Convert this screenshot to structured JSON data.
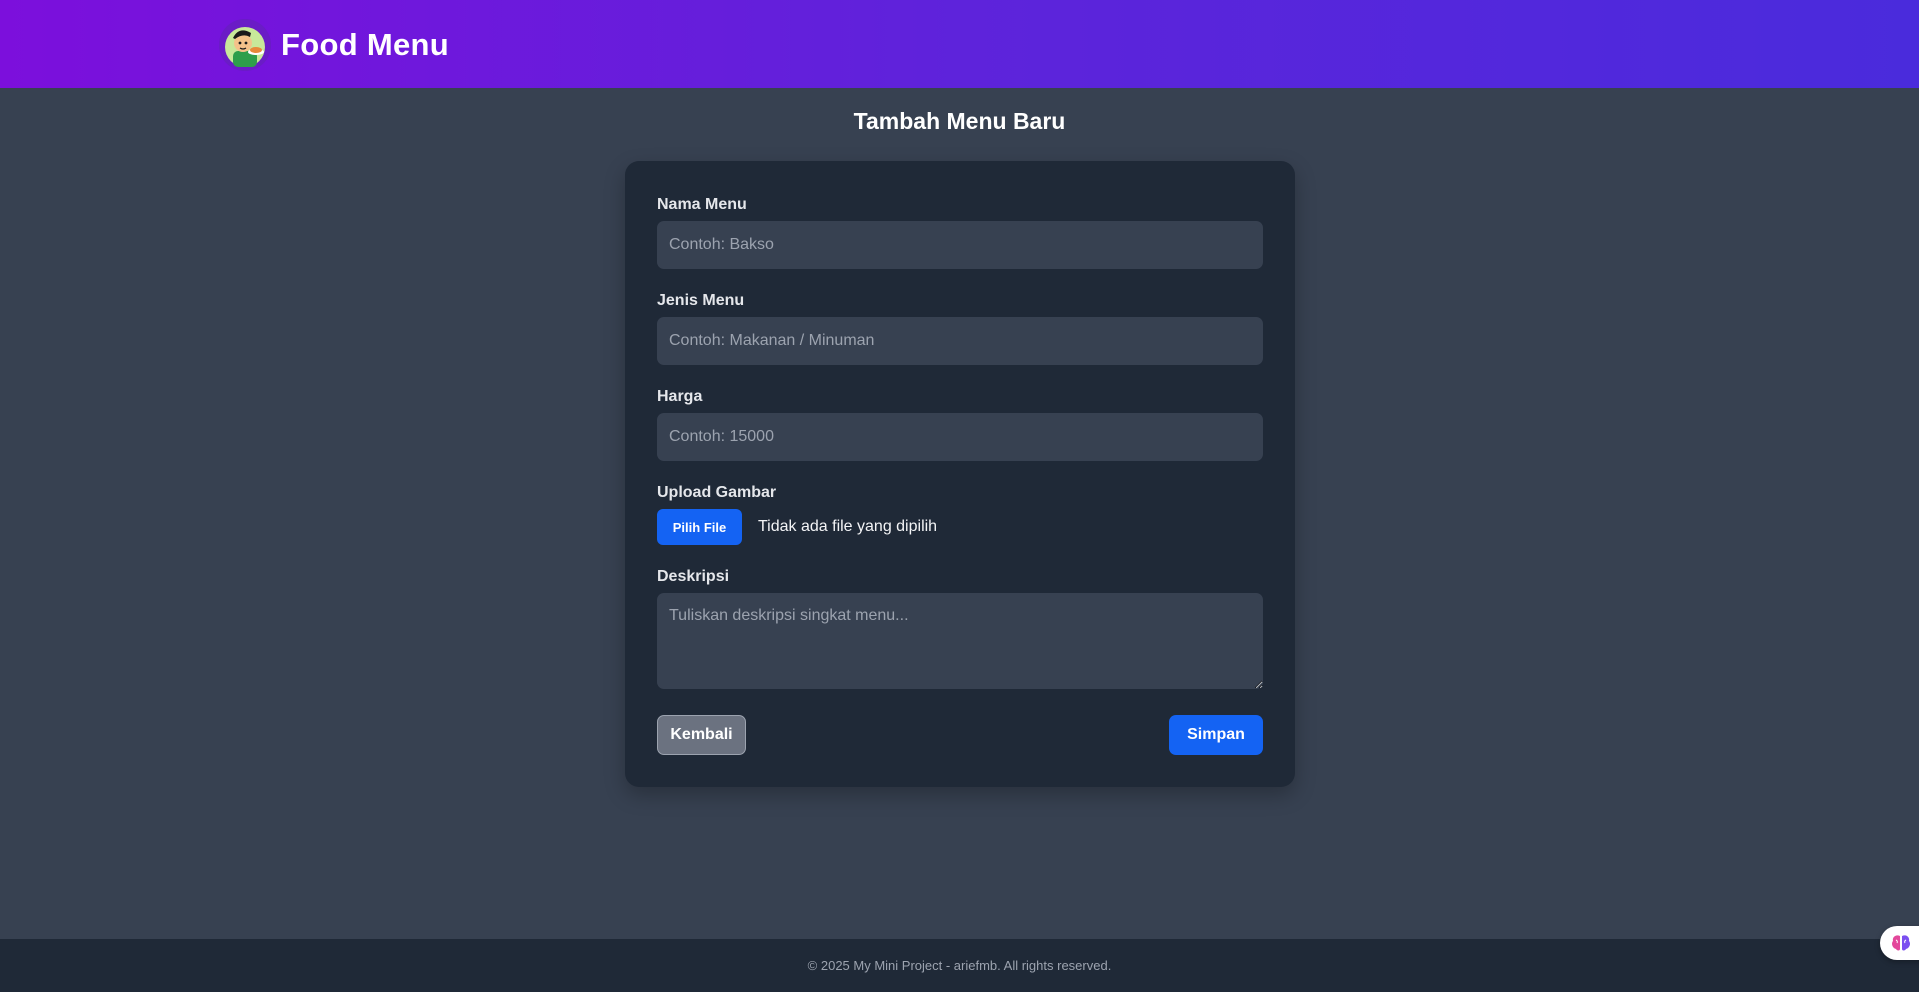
{
  "navbar": {
    "brand_title": "Food Menu",
    "logo_icon": "chef-mascot-icon"
  },
  "page": {
    "title": "Tambah Menu Baru"
  },
  "form": {
    "fields": [
      {
        "label": "Nama Menu",
        "placeholder": "Contoh: Bakso",
        "value": ""
      },
      {
        "label": "Jenis Menu",
        "placeholder": "Contoh: Makanan / Minuman",
        "value": ""
      },
      {
        "label": "Harga",
        "placeholder": "Contoh: 15000",
        "value": ""
      }
    ],
    "upload": {
      "label": "Upload Gambar",
      "button_label": "Pilih File",
      "status": "Tidak ada file yang dipilih"
    },
    "description": {
      "label": "Deskripsi",
      "placeholder": "Tuliskan deskripsi singkat menu...",
      "value": ""
    },
    "back_label": "Kembali",
    "save_label": "Simpan"
  },
  "footer": {
    "text": "© 2025 My Mini Project - ariefmb. All rights reserved."
  },
  "floating": {
    "icon": "brain-icon"
  },
  "colors": {
    "header_gradient_start": "#7c0fdc",
    "header_gradient_end": "#4a2bdc",
    "background": "#374151",
    "card": "#1f2937",
    "primary_button": "#1463f3",
    "secondary_button": "#6b7280"
  }
}
